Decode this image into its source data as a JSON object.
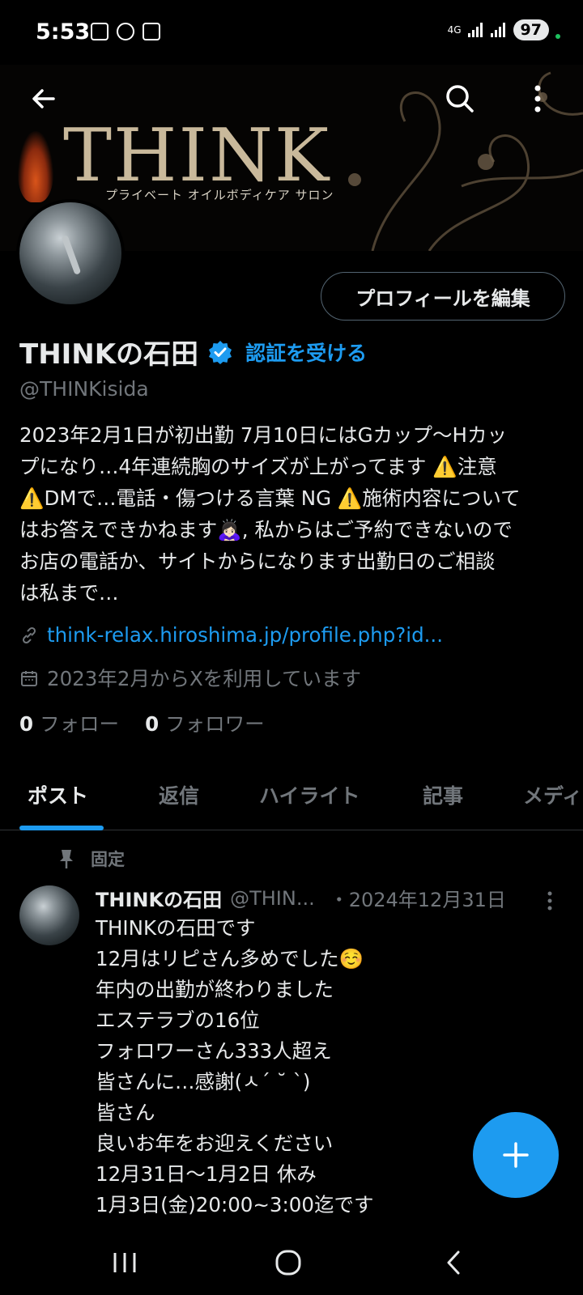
{
  "status_bar": {
    "time": "5:53",
    "network": "4G",
    "battery": "97"
  },
  "banner": {
    "logo_text": "THINK",
    "tagline": "プライベート オイルボディケア サロン"
  },
  "header": {
    "back_icon": "arrow-left-icon",
    "search_icon": "search-icon",
    "more_icon": "more-vertical-icon"
  },
  "profile": {
    "edit_button": "プロフィールを編集",
    "name": "THINKの石田",
    "get_verified": "認証を受ける",
    "handle": "@THINKisida",
    "bio_lines": [
      "2023年2月1日が初出勤 7月10日にはGカップ〜Hカッ",
      "プになり…4年連続胸のサイズが上がってます ⚠️注意",
      "⚠️DMで…電話・傷つける言葉 NG ⚠️施術内容について",
      "はお答えできかねます🙇🏻‍♀️, 私からはご予約できないので",
      "お店の電話か、サイトからになります出勤日のご相談",
      "は私まで…"
    ],
    "link": "think-relax.hiroshima.jp/profile.php?id...",
    "joined": "2023年2月からXを利用しています",
    "following_count": "0",
    "following_label": "フォロー",
    "followers_count": "0",
    "followers_label": "フォロワー"
  },
  "tabs": [
    "ポスト",
    "返信",
    "ハイライト",
    "記事",
    "メディ"
  ],
  "pinned_post": {
    "pinned_label": "固定",
    "author_name": "THINKの石田",
    "author_handle": "@THIN...",
    "date": "・2024年12月31日",
    "lines": [
      "THINKの石田です",
      "12月はリピさん多めでした☺️",
      "年内の出勤が終わりました",
      "エステラブの16位",
      "フォロワーさん333人超え",
      "皆さんに…感謝(ㅅ´ ˘ `)",
      "皆さん",
      "良いお年をお迎えください",
      "12月31日〜1月2日 休み",
      "1月3日(金)20:00~3:00迄です"
    ]
  },
  "fab_icon": "plus-icon",
  "colors": {
    "accent": "#1d9bf0",
    "text": "#e7e9ea",
    "muted": "#71767b",
    "background": "#000000"
  }
}
